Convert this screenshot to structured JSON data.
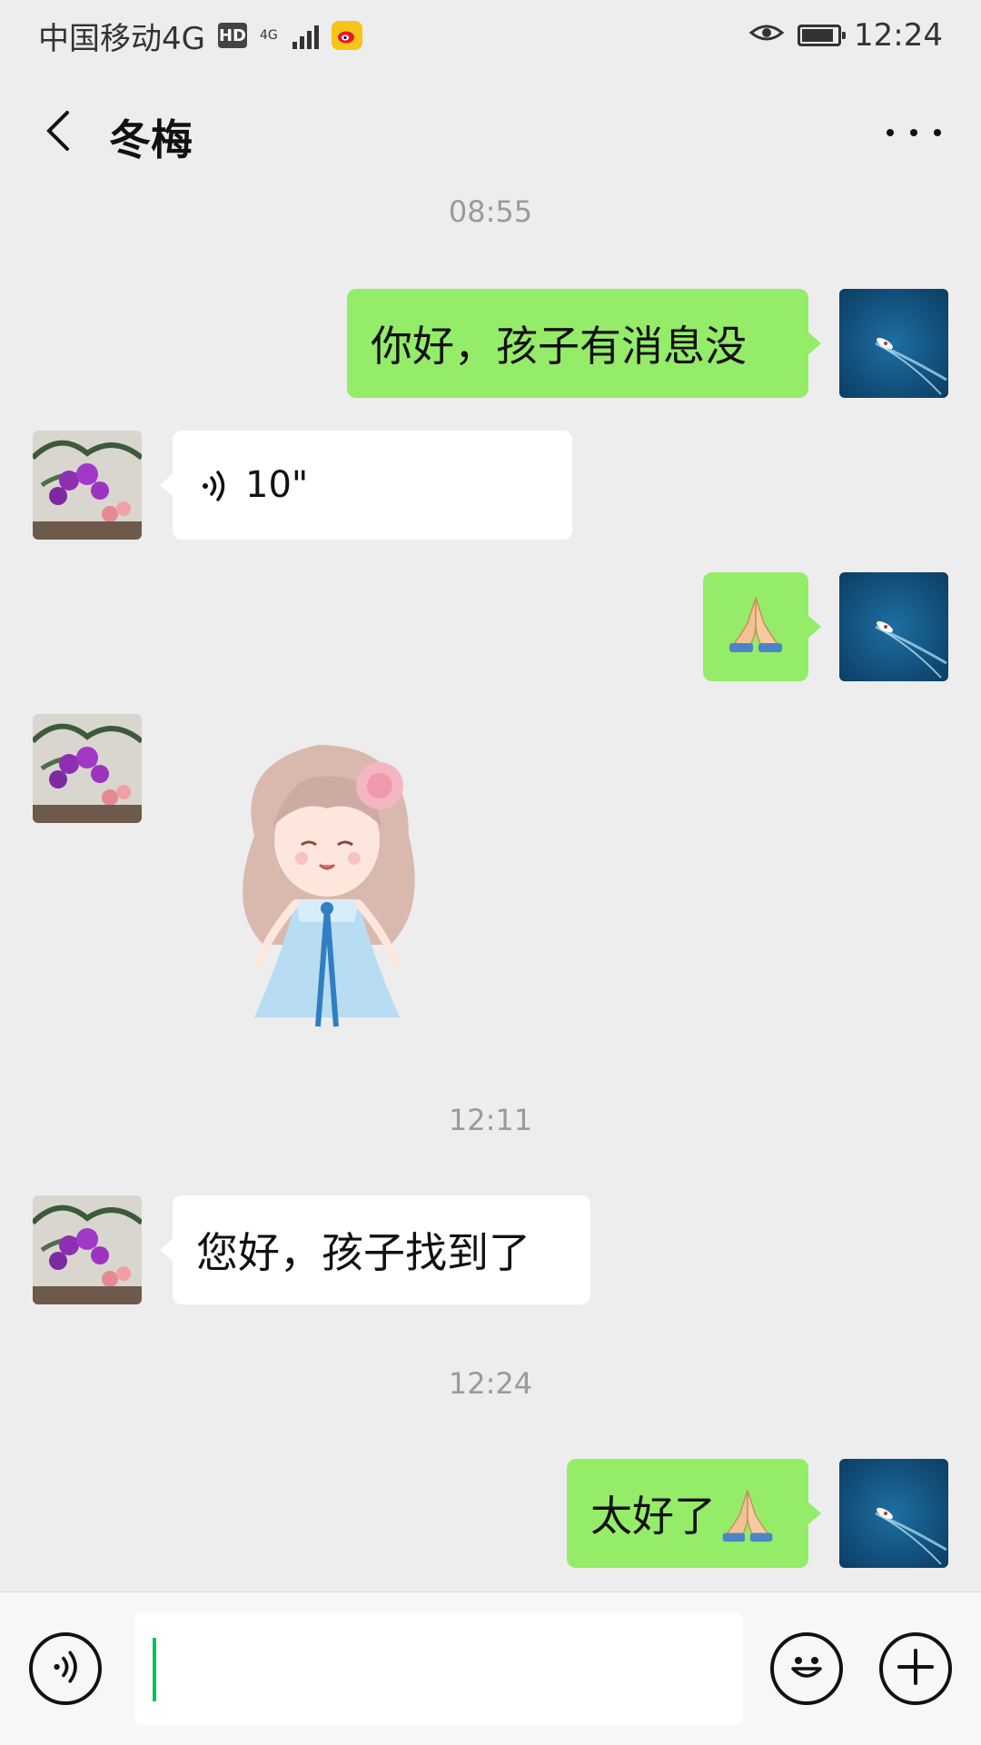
{
  "status_bar": {
    "carrier": "中国移动4G",
    "hd": "HD",
    "network": "4G",
    "time": "12:24"
  },
  "header": {
    "title": "冬梅"
  },
  "messages": [
    {
      "type": "timestamp",
      "text": "08:55"
    },
    {
      "type": "text",
      "side": "self",
      "text": "你好，孩子有消息没"
    },
    {
      "type": "voice",
      "side": "other",
      "duration": "10\""
    },
    {
      "type": "emoji",
      "side": "self",
      "icon": "pray-emoji-icon"
    },
    {
      "type": "sticker",
      "side": "other",
      "icon": "girl-sticker-icon"
    },
    {
      "type": "timestamp",
      "text": "12:11"
    },
    {
      "type": "text",
      "side": "other",
      "text": "您好，孩子找到了"
    },
    {
      "type": "timestamp",
      "text": "12:24"
    },
    {
      "type": "text",
      "side": "self",
      "text": "太好了",
      "trailing_icon": "pray-emoji-icon"
    }
  ],
  "input": {
    "value": ""
  },
  "colors": {
    "self_bubble": "#95ec69",
    "other_bubble": "#ffffff",
    "background": "#ededed",
    "cursor": "#07c160"
  }
}
